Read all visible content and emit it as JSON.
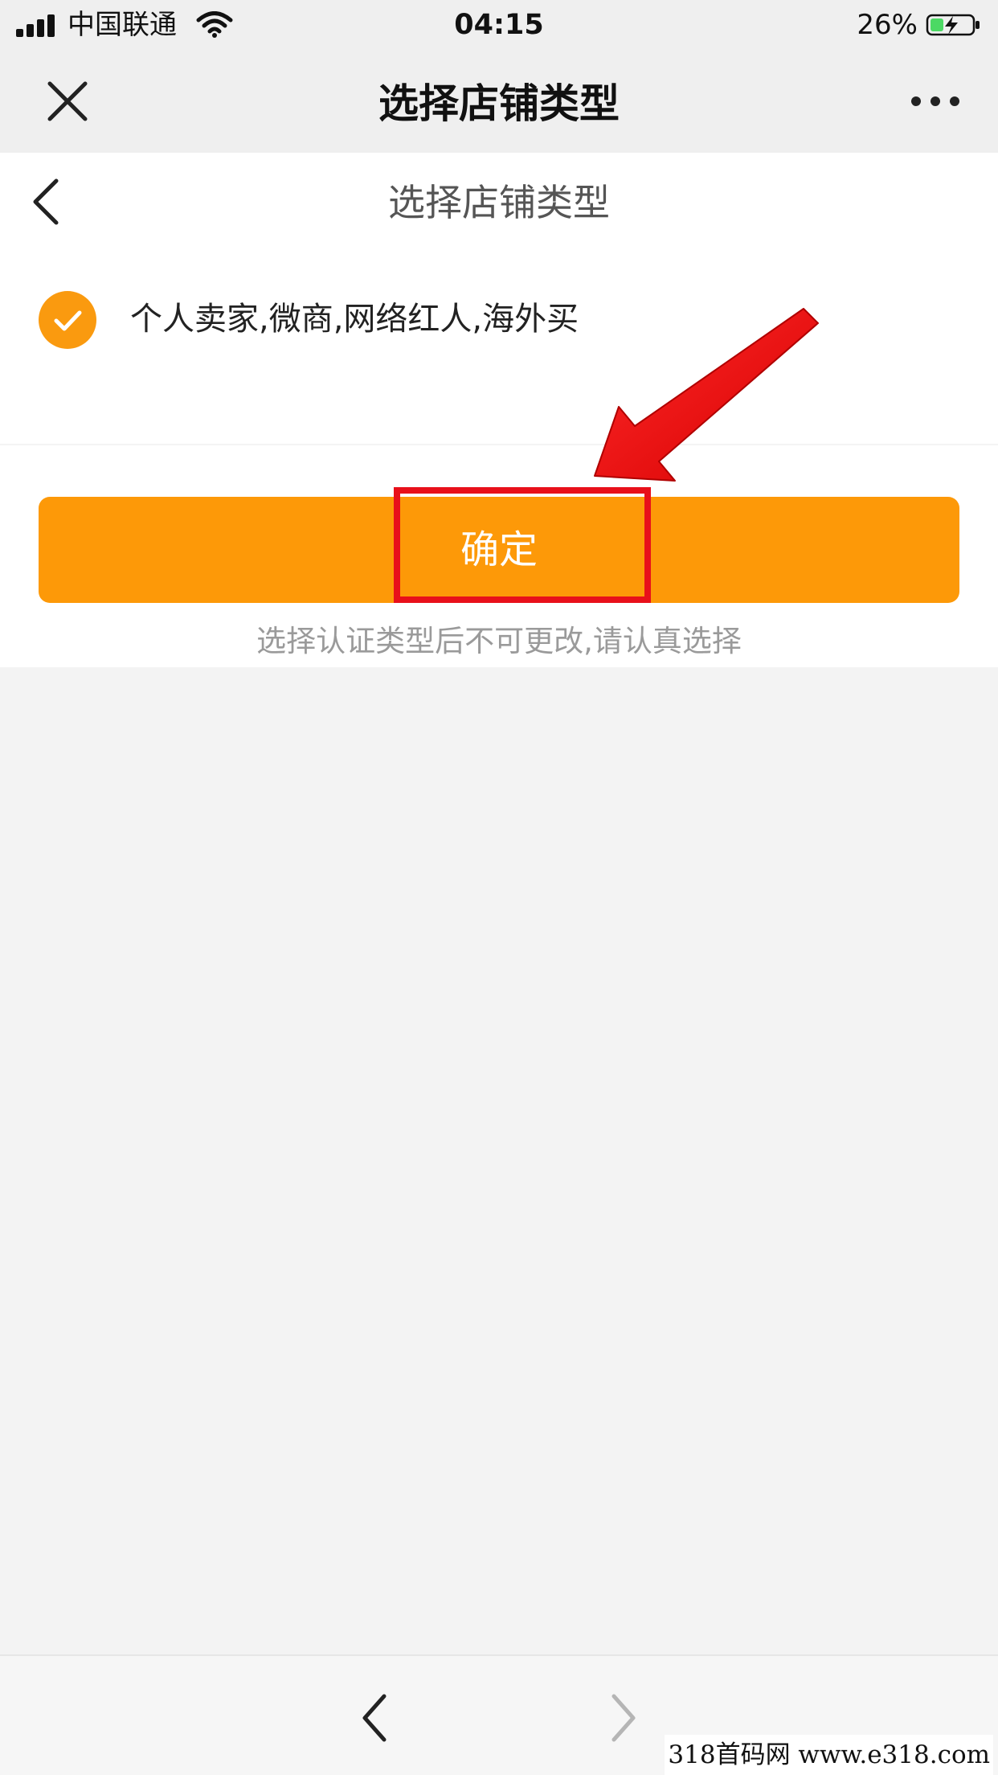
{
  "status_bar": {
    "carrier": "中国联通",
    "time": "04:15",
    "battery_percent": "26%"
  },
  "title_bar": {
    "title": "选择店铺类型",
    "close_icon": "close-icon",
    "more_icon": "more-icon"
  },
  "page": {
    "title": "选择店铺类型",
    "back_icon": "chevron-left-icon",
    "option": {
      "label": "个人卖家,微商,网络红人,海外买",
      "selected": true
    },
    "confirm_label": "确定",
    "warning": "选择认证类型后不可更改,请认真选择"
  },
  "bottom_bar": {
    "back_icon": "chevron-left-icon",
    "forward_icon": "chevron-right-icon"
  },
  "watermark": "318首码网 www.e318.com",
  "colors": {
    "accent": "#fd9908",
    "annotation": "#e8101a"
  }
}
